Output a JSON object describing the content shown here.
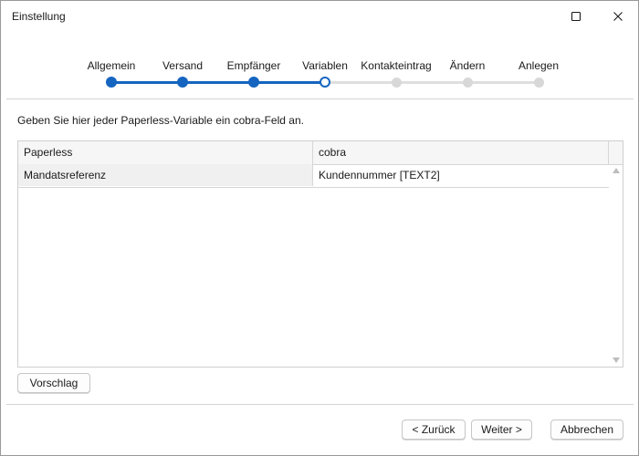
{
  "window": {
    "title": "Einstellung"
  },
  "stepper": {
    "steps": [
      {
        "label": "Allgemein",
        "state": "done"
      },
      {
        "label": "Versand",
        "state": "done"
      },
      {
        "label": "Empfänger",
        "state": "done"
      },
      {
        "label": "Variablen",
        "state": "current"
      },
      {
        "label": "Kontakteintrag",
        "state": "todo"
      },
      {
        "label": "Ändern",
        "state": "todo"
      },
      {
        "label": "Anlegen",
        "state": "todo"
      }
    ],
    "colors": {
      "active": "#1565c0",
      "inactive": "#dedede"
    }
  },
  "main": {
    "instruction": "Geben Sie hier jeder Paperless-Variable ein cobra-Feld an.",
    "grid": {
      "columns": [
        "Paperless",
        "cobra"
      ],
      "rows": [
        [
          "Mandatsreferenz",
          "Kundennummer [TEXT2]"
        ]
      ]
    },
    "suggest_label": "Vorschlag"
  },
  "footer": {
    "back_label": "< Zurück",
    "next_label": "Weiter >",
    "cancel_label": "Abbrechen"
  }
}
